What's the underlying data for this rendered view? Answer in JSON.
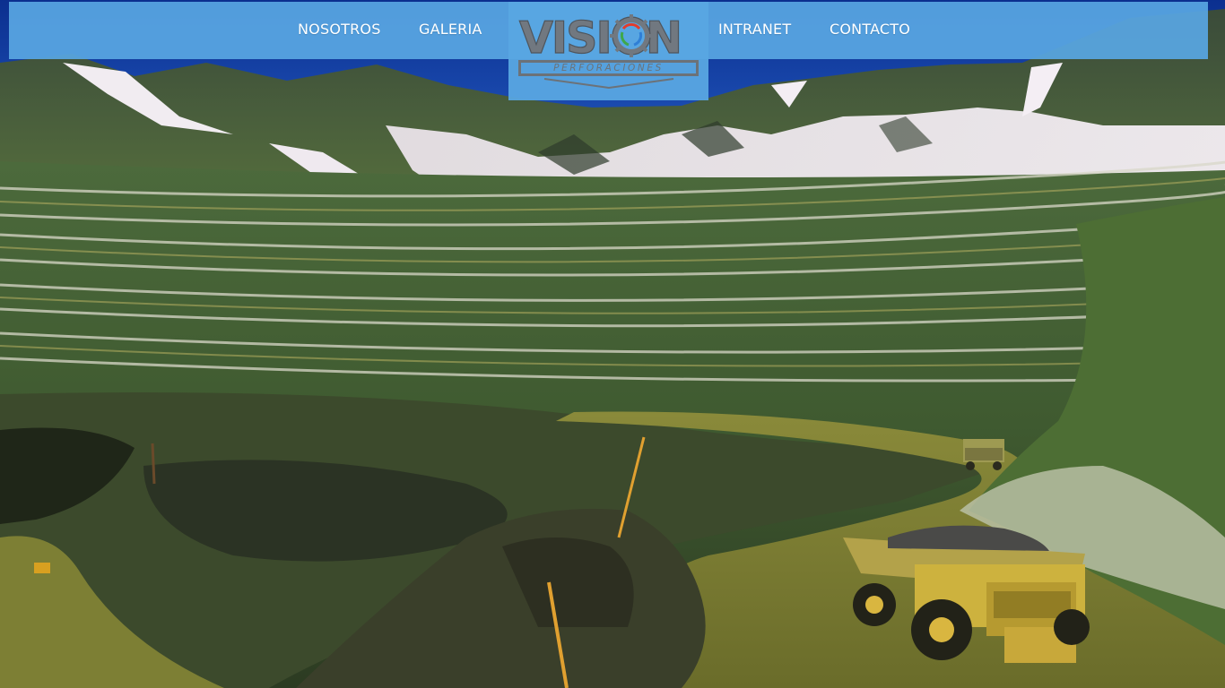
{
  "nav": {
    "left": [
      {
        "label": "NOSOTROS"
      },
      {
        "label": "GALERIA"
      }
    ],
    "right": [
      {
        "label": "INTRANET"
      },
      {
        "label": "CONTACTO"
      }
    ]
  },
  "logo": {
    "word_before": "VISI",
    "word_after": "N",
    "subtitle": "PERFORACIONES"
  },
  "colors": {
    "nav_background": "#58a6e2",
    "nav_text": "#ffffff",
    "logo_grey": "#6c7278",
    "logo_ring": [
      "#e23c2c",
      "#2f7fd6",
      "#3fa84a"
    ]
  },
  "hero": {
    "image": "open-pit mine with terraced benches, snowy mountains and haul trucks"
  }
}
